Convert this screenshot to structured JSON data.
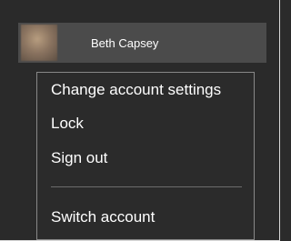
{
  "user": {
    "name": "Beth Capsey"
  },
  "menu": {
    "items": [
      {
        "label": "Change account settings"
      },
      {
        "label": "Lock"
      },
      {
        "label": "Sign out"
      },
      {
        "label": "Switch account"
      }
    ]
  }
}
